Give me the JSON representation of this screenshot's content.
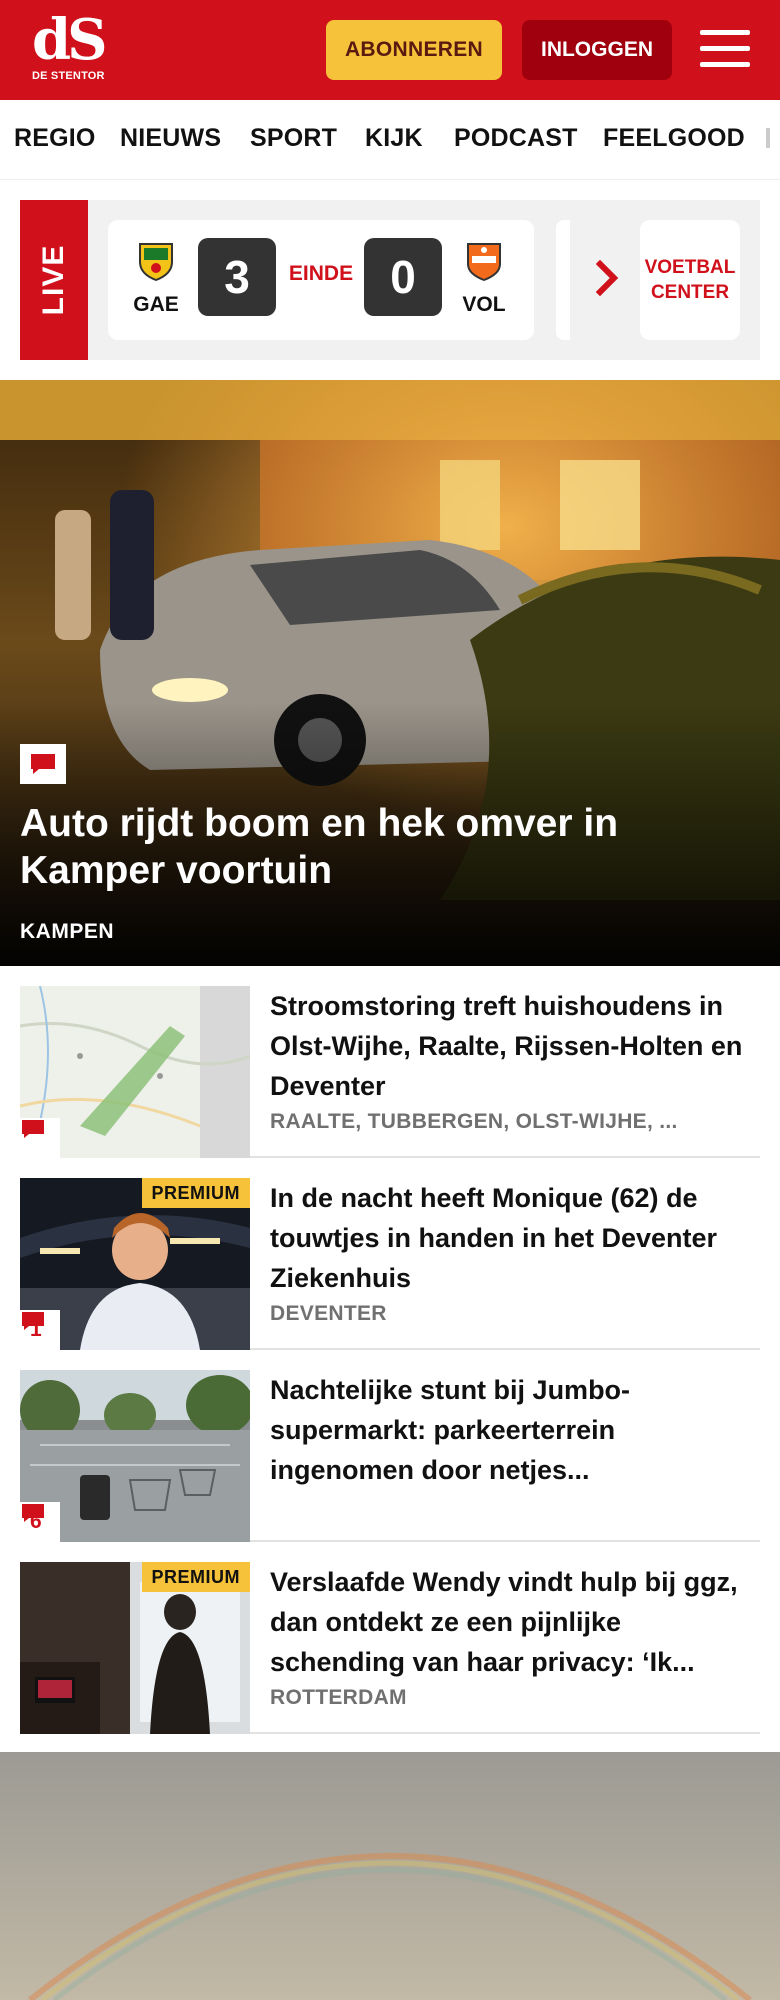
{
  "header": {
    "logo_mark": "dS",
    "logo_sub": "DE STENTOR",
    "subscribe_label": "ABONNEREN",
    "login_label": "INLOGGEN",
    "menu_icon": "hamburger-menu-icon",
    "brand_color": "#d0101a"
  },
  "nav": {
    "items": [
      "REGIO",
      "NIEUWS",
      "SPORT",
      "KIJK",
      "PODCAST",
      "FEELGOOD"
    ]
  },
  "live": {
    "tag": "LIVE",
    "home_code": "GAE",
    "home_score": "3",
    "status": "EINDE",
    "away_score": "0",
    "away_code": "VOL",
    "center_label_line1": "VOETBAL",
    "center_label_line2": "CENTER"
  },
  "hero": {
    "title": "Auto rijdt boom en hek omver in Kamper voortuin",
    "location": "KAMPEN"
  },
  "articles": [
    {
      "title": "Stroomstoring treft huishoudens in Olst-Wijhe, Raalte, Rijssen-Holten en Deventer",
      "location": "RAALTE, TUBBERGEN, OLST-WIJHE, ...",
      "comments": "",
      "premium": ""
    },
    {
      "title": "In de nacht heeft Monique (62) de touwtjes in handen in het Deventer Ziekenhuis",
      "location": "DEVENTER",
      "comments": "1",
      "premium": "PREMIUM"
    },
    {
      "title": "Nachtelijke stunt bij Jumbo-supermarkt: parkeerterrein ingenomen door netjes...",
      "location": "",
      "comments": "6",
      "premium": ""
    },
    {
      "title": "Verslaafde Wendy vindt hulp bij ggz, dan ontdekt ze een pijnlijke schending van haar privacy: ‘Ik...",
      "location": "ROTTERDAM",
      "comments": "",
      "premium": "PREMIUM"
    }
  ]
}
